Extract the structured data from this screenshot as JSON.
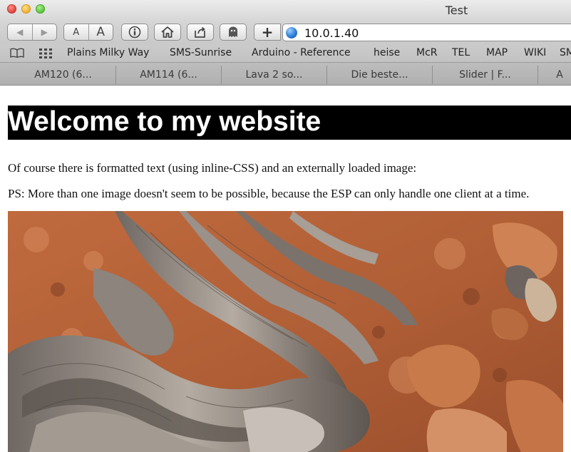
{
  "window": {
    "title": "Test"
  },
  "toolbar": {
    "back": "◀",
    "forward": "▶",
    "font_small": "A",
    "font_large": "A",
    "reader_icon": "info-icon",
    "home_icon": "home-icon",
    "share_icon": "share-icon",
    "ghostery_icon": "ghost-icon",
    "add": "+",
    "url": "10.0.1.40"
  },
  "bookmarks": {
    "items": [
      "Plains Milky Way",
      "SMS-Sunrise",
      "Arduino - Reference",
      "heise",
      "McR",
      "TEL",
      "MAP",
      "WIKI",
      "SM"
    ]
  },
  "tabs": [
    "AM120 (6...",
    "AM114 (6...",
    "Lava 2 so...",
    "Die beste...",
    "Slider | F...",
    "A"
  ],
  "page": {
    "heading": "Welcome to my website",
    "paragraph1": "Of course there is formatted text (using inline-CSS) and an externally loaded image:",
    "paragraph2": "PS: More than one image doesn't seem to be possible, because the ESP can only handle one client at a time."
  },
  "colors": {
    "heading_bg": "#000000",
    "heading_text": "#ffffff",
    "earth": "#b8623a",
    "wood": "#8a8078"
  }
}
